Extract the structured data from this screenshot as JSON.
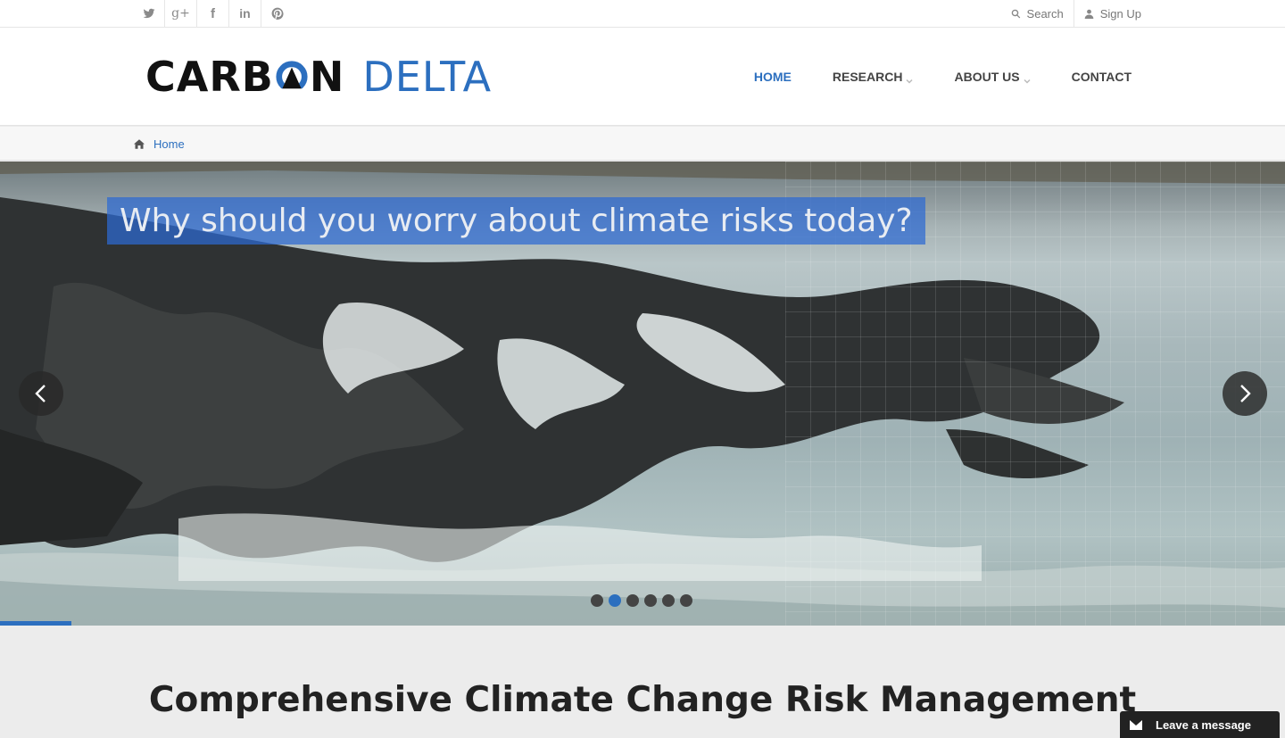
{
  "topbar": {
    "social": [
      {
        "name": "twitter-icon"
      },
      {
        "name": "google-plus-icon",
        "glyph": "g+"
      },
      {
        "name": "facebook-icon",
        "glyph": "f"
      },
      {
        "name": "linkedin-icon",
        "glyph": "in"
      },
      {
        "name": "pinterest-icon"
      }
    ],
    "search_label": "Search",
    "signup_label": "Sign Up"
  },
  "header": {
    "logo_left": "CARB",
    "logo_mid": "N",
    "logo_right": "DELTA",
    "nav": [
      {
        "label": "HOME",
        "active": true,
        "dropdown": false
      },
      {
        "label": "RESEARCH",
        "active": false,
        "dropdown": true
      },
      {
        "label": "ABOUT US",
        "active": false,
        "dropdown": true
      },
      {
        "label": "CONTACT",
        "active": false,
        "dropdown": false
      }
    ]
  },
  "breadcrumb": {
    "home_label": "Home"
  },
  "hero": {
    "caption": "Why should you worry about climate risks today?",
    "slide_count": 6,
    "active_slide": 2
  },
  "section": {
    "title": "Comprehensive Climate Change Risk Management"
  },
  "chat": {
    "label": "Leave a message"
  },
  "colors": {
    "accent": "#2c6fbf",
    "text_dark": "#222222"
  }
}
